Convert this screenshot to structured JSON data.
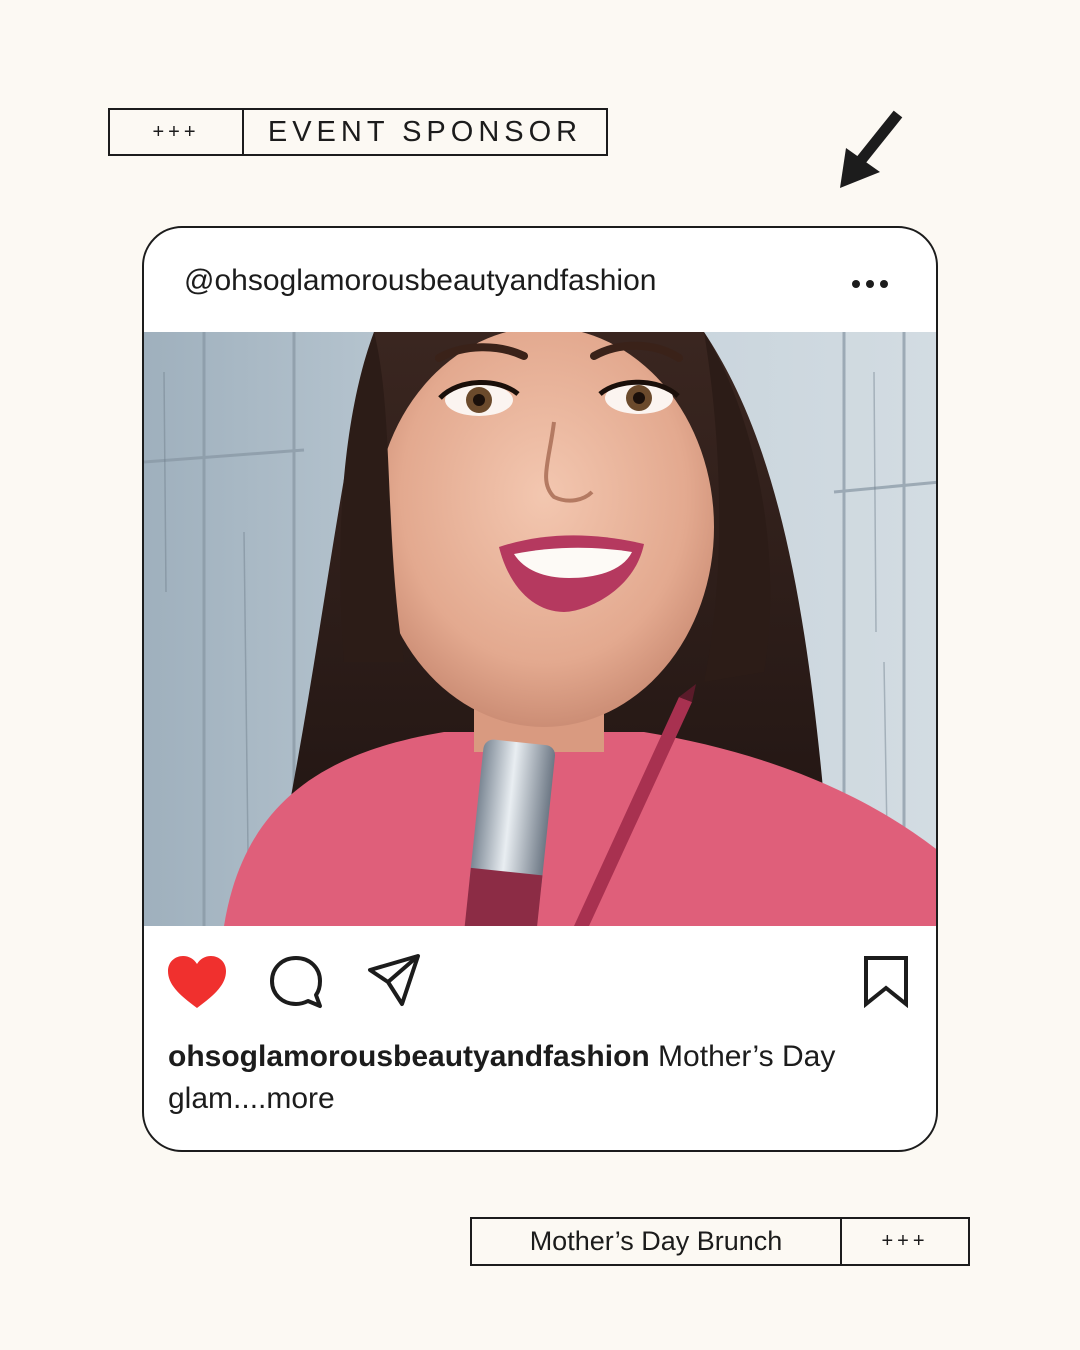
{
  "top_label": {
    "stars": "+++",
    "text": "EVENT SPONSOR"
  },
  "post": {
    "handle": "@ohsoglamorousbeautyandfashion",
    "photo_icon": "photo-woman-holding-lipstick",
    "actions": {
      "like_icon": "heart-icon",
      "like_color": "#f0302e",
      "comment_icon": "comment-icon",
      "share_icon": "send-icon",
      "save_icon": "bookmark-icon"
    },
    "caption": {
      "username": "ohsoglamorousbeautyandfashion",
      "text": " Mother’s Day glam....more"
    }
  },
  "bottom_label": {
    "text": "Mother’s Day Brunch",
    "stars": "+++"
  },
  "colors": {
    "background": "#fcf9f3",
    "ink": "#1c1c1c",
    "card": "#ffffff"
  }
}
